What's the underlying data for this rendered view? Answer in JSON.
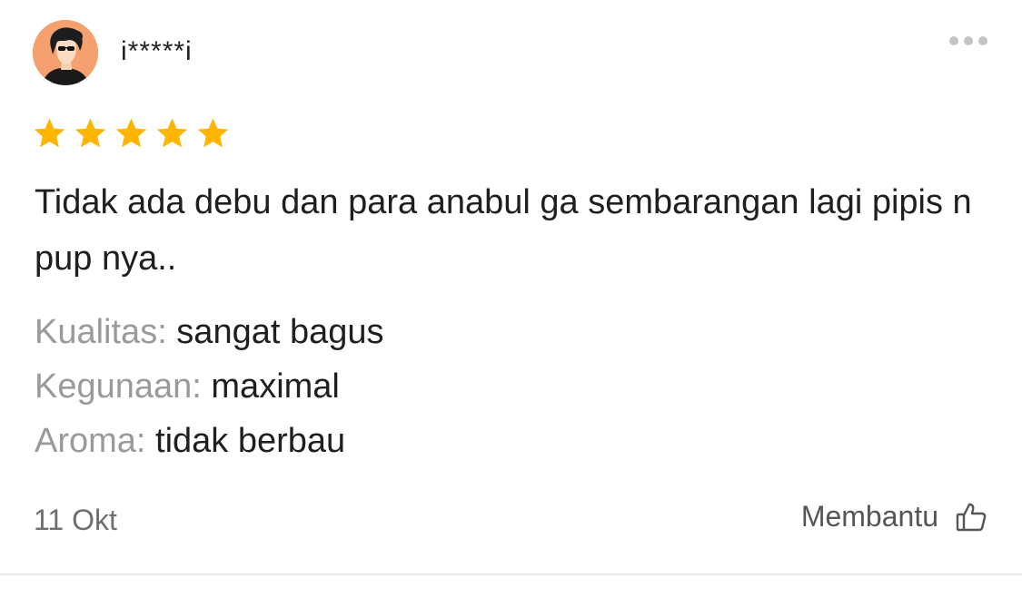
{
  "review": {
    "username": "i*****i",
    "avatar_icon": "user-avatar-icon",
    "more_icon": "more-options-icon",
    "rating": 5,
    "rating_max": 5,
    "star_color": "#ffb400",
    "text": "Tidak ada debu dan para anabul ga sembarangan lagi pipis n pup nya..",
    "attributes": [
      {
        "label": "Kualitas:",
        "value": "sangat bagus"
      },
      {
        "label": "Kegunaan:",
        "value": "maximal"
      },
      {
        "label": "Aroma:",
        "value": "tidak berbau"
      }
    ],
    "date": "11 Okt",
    "helpful_label": "Membantu",
    "helpful_icon": "thumbs-up-icon"
  }
}
